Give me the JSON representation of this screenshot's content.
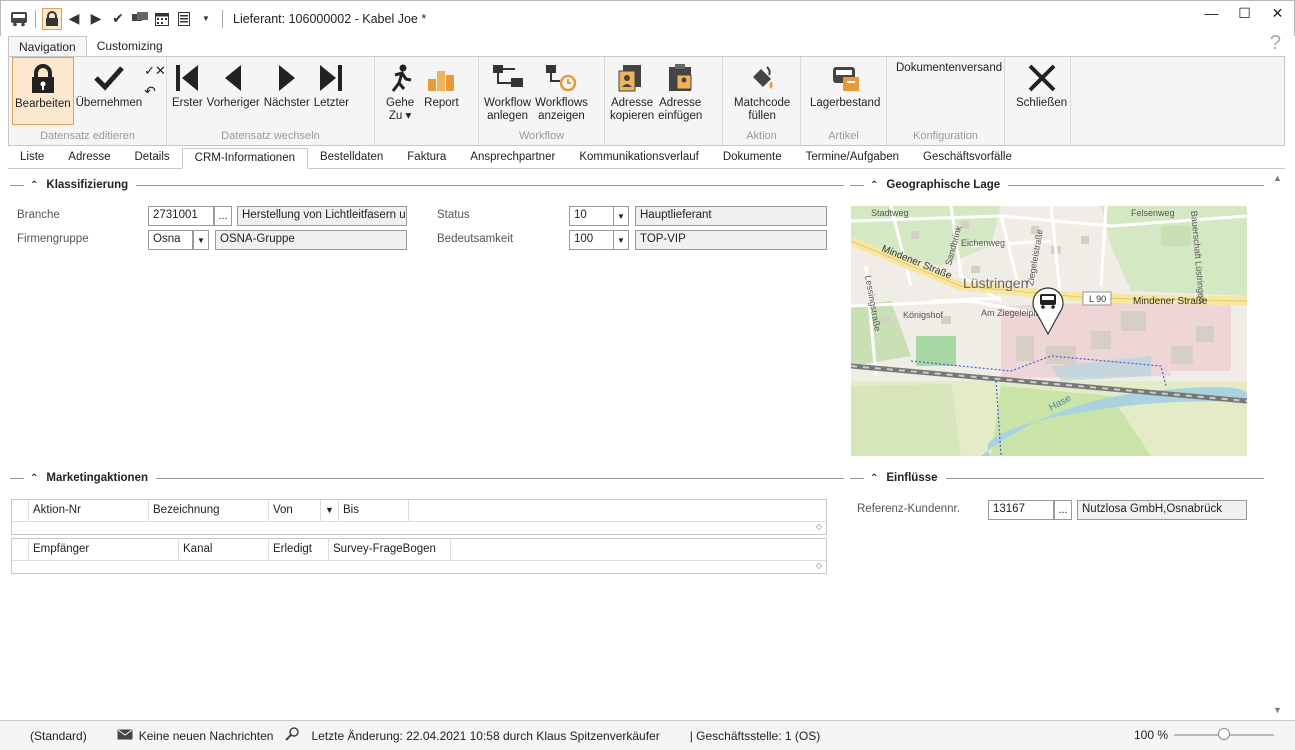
{
  "window": {
    "title": "Lieferant: 106000002 - Kabel Joe *",
    "controls": [
      "minimize-icon",
      "maximize-icon",
      "close-icon"
    ]
  },
  "ribbon_tabs": [
    {
      "label": "Navigation",
      "active": true
    },
    {
      "label": "Customizing",
      "active": false
    }
  ],
  "help_label": "?",
  "ribbon": {
    "groups": {
      "datensatz_editieren": "Datensatz editieren",
      "datensatz_wechseln": "Datensatz wechseln",
      "workflow": "Workflow",
      "aktion": "Aktion",
      "artikel": "Artikel",
      "konfiguration": "Konfiguration"
    },
    "buttons": {
      "bearbeiten": "Bearbeiten",
      "uebernehmen": "Übernehmen",
      "erster": "Erster",
      "vorheriger": "Vorheriger",
      "naechster": "Nächster",
      "letzter": "Letzter",
      "gehe_zu": "Gehe\nZu ▾",
      "report": "Report",
      "workflow_anlegen": "Workflow\nanlegen",
      "workflows_anzeigen": "Workflows\nanzeigen",
      "adresse_kopieren": "Adresse\nkopieren",
      "adresse_einfuegen": "Adresse\neinfügen",
      "matchcode_fuellen": "Matchcode\nfüllen",
      "lagerbestand": "Lagerbestand",
      "dokumentenversand": "Dokumentenversand",
      "schliessen": "Schließen"
    }
  },
  "content_tabs": [
    {
      "label": "Liste"
    },
    {
      "label": "Adresse"
    },
    {
      "label": "Details"
    },
    {
      "label": "CRM-Informationen",
      "active": true
    },
    {
      "label": "Bestelldaten"
    },
    {
      "label": "Faktura"
    },
    {
      "label": "Ansprechpartner"
    },
    {
      "label": "Kommunikationsverlauf"
    },
    {
      "label": "Dokumente"
    },
    {
      "label": "Termine/Aufgaben"
    },
    {
      "label": "Geschäftsvorfälle"
    }
  ],
  "klassifizierung": {
    "title": "Klassifizierung",
    "branche_label": "Branche",
    "branche_code": "2731001",
    "branche_text": "Herstellung von Lichtleitfasern un",
    "firmengruppe_label": "Firmengruppe",
    "firmengruppe_code": "Osna",
    "firmengruppe_text": "OSNA-Gruppe",
    "status_label": "Status",
    "status_code": "10",
    "status_text": "Hauptlieferant",
    "bedeutsamkeit_label": "Bedeutsamkeit",
    "bedeutsamkeit_code": "100",
    "bedeutsamkeit_text": "TOP-VIP",
    "dots": "..."
  },
  "geo": {
    "title": "Geographische Lage",
    "map_labels": {
      "town": "Lüstringen",
      "road1": "Mindener Straße",
      "road2": "Mindener Straße",
      "route": "L 90",
      "river": "Hase",
      "s1": "Stadtweg",
      "s2": "Eichenweg",
      "s3": "Felsenweg",
      "s4": "Ziegeleistraße",
      "s5": "Am Ziegeleiplatz",
      "s6": "Königshof",
      "s7": "Lessingstraße",
      "s8": "Sandbrink",
      "s9": "Bauerschaft Lüstringen"
    }
  },
  "marketing": {
    "title": "Marketingaktionen",
    "grid1_cols": [
      "Aktion-Nr",
      "Bezeichnung",
      "Von",
      "Bis"
    ],
    "grid2_cols": [
      "Empfänger",
      "Kanal",
      "Erledigt",
      "Survey-FrageBogen"
    ]
  },
  "einfluesse": {
    "title": "Einflüsse",
    "ref_label": "Referenz-Kundennr.",
    "ref_code": "13167",
    "ref_text": "Nutzlosa GmbH,Osnabrück",
    "dots": "..."
  },
  "statusbar": {
    "profile": "(Standard)",
    "messages": "Keine neuen Nachrichten",
    "last_change": "Letzte Änderung: 22.04.2021 10:58 durch Klaus Spitzenverkäufer",
    "branch": "| Geschäftsstelle: 1 (OS)",
    "zoom": "100 %",
    "zoom_level": 0.5
  }
}
